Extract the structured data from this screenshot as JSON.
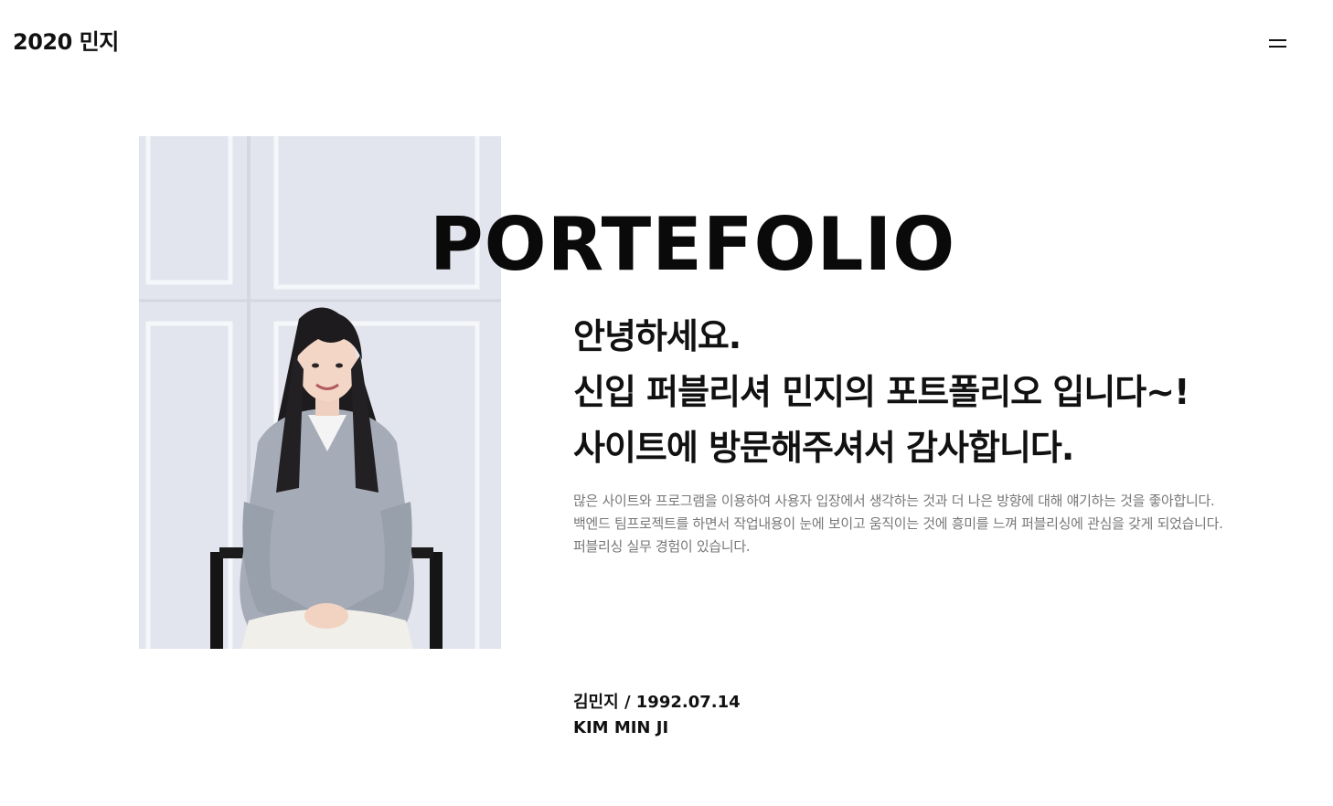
{
  "header": {
    "logo_text": "2020 민지",
    "menu_icon": "hamburger-menu-icon"
  },
  "hero": {
    "title": "PORTEFOLIO",
    "photo_alt": "portrait-photo",
    "greeting_lines": [
      "안녕하세요.",
      "신입 퍼블리셔 민지의 포트폴리오 입니다~!",
      "사이트에 방문해주셔서 감사합니다."
    ],
    "description_lines": [
      "많은 사이트와 프로그램을 이용하여 사용자 입장에서 생각하는 것과 더 나은 방향에 대해 얘기하는 것을 좋아합니다.",
      "백엔드 팀프로젝트를 하면서 작업내용이 눈에 보이고 움직이는 것에 흥미를 느껴 퍼블리싱에 관심을 갖게 되었습니다.",
      "퍼블리싱 실무 경험이 있습니다."
    ],
    "profile_name_birth": "김민지 / 1992.07.14",
    "profile_name_en": "KIM MIN JI"
  },
  "colors": {
    "text_primary": "#111111",
    "text_muted": "#777777",
    "background": "#ffffff"
  }
}
